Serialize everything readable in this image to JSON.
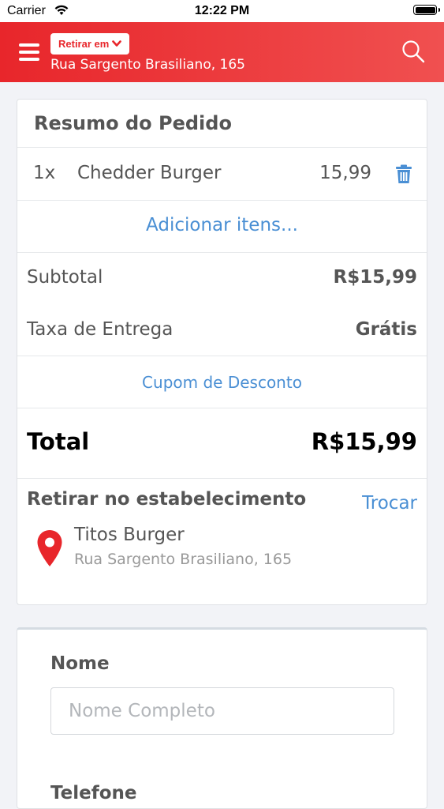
{
  "status_bar": {
    "carrier": "Carrier",
    "time": "12:22 PM"
  },
  "header": {
    "mode_label": "Retirar em",
    "address": "Rua Sargento Brasiliano, 165",
    "background_color": "#e8262b"
  },
  "summary": {
    "title": "Resumo do Pedido",
    "items": [
      {
        "qty": "1x",
        "name": "Chedder Burger",
        "price": "15,99"
      }
    ],
    "add_items_label": "Adicionar itens...",
    "subtotal_label": "Subtotal",
    "subtotal_value": "R$15,99",
    "delivery_label": "Taxa de Entrega",
    "delivery_value": "Grátis",
    "coupon_label": "Cupom de Desconto",
    "total_label": "Total",
    "total_value": "R$15,99"
  },
  "pickup": {
    "title": "Retirar no estabelecimento",
    "change_label": "Trocar",
    "store_name": "Titos Burger",
    "store_address": "Rua Sargento Brasiliano, 165"
  },
  "form": {
    "name_label": "Nome",
    "name_placeholder": "Nome Completo",
    "name_value": "",
    "phone_label": "Telefone"
  },
  "icons": {
    "menu": "menu-icon",
    "search": "search-icon",
    "trash": "trash-icon",
    "pin": "location-pin-icon",
    "chevron": "chevron-down-icon"
  },
  "colors": {
    "accent": "#e8262b",
    "link": "#4a8fd4",
    "trash": "#4a8fd4"
  }
}
